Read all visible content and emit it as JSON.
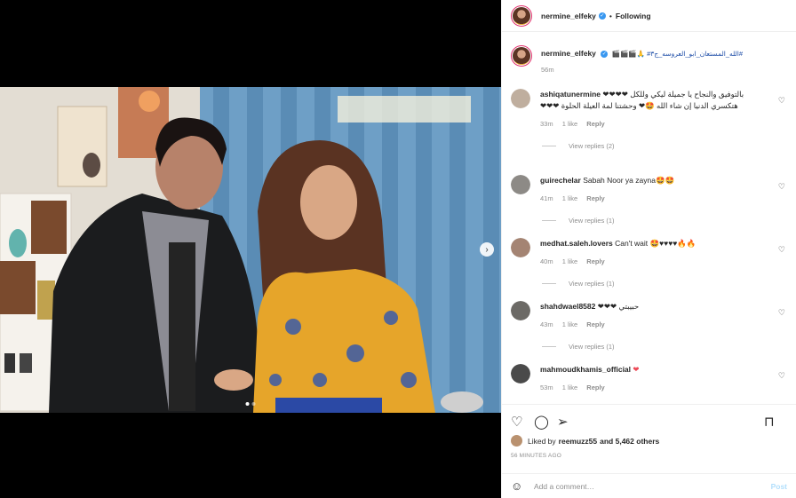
{
  "header": {
    "username": "nermine_elfeky",
    "separator": "•",
    "follow_label": "Following"
  },
  "caption": {
    "username": "nermine_elfeky",
    "text": "#الله_المستعان_ابو_العروسه_ج٣# 🙏🎬🎬🎬",
    "time": "56m"
  },
  "comments": [
    {
      "username": "ashiqatunermine",
      "text": "بالتوفيق والنجاح يا جميلة ليكي وللكل ❤❤❤❤ هتكسري الدنيا إن شاء الله 🤩❤ وحشتنا لمة العيلة الحلوة ❤❤❤",
      "time": "33m",
      "likes": "1 like",
      "reply": "Reply",
      "view_replies": "View replies (2)"
    },
    {
      "username": "guirechelar",
      "text": "Sabah Noor ya zayna🤩🤩",
      "time": "41m",
      "likes": "1 like",
      "reply": "Reply",
      "view_replies": "View replies (1)"
    },
    {
      "username": "medhat.saleh.lovers",
      "text": "Can't wait 🤩♥♥♥♥🔥🔥",
      "time": "40m",
      "likes": "1 like",
      "reply": "Reply",
      "view_replies": "View replies (1)"
    },
    {
      "username": "shahdwael8582",
      "text": "حبيبتي ❤❤❤",
      "time": "43m",
      "likes": "1 like",
      "reply": "Reply",
      "view_replies": "View replies (1)"
    },
    {
      "username": "mahmoudkhamis_official",
      "text": "❤",
      "time": "53m",
      "likes": "1 like",
      "reply": "Reply"
    }
  ],
  "likes_summary": {
    "prefix": "Liked by",
    "user": "reemuzz55",
    "suffix": "and 5,462 others"
  },
  "posted_ago": "56 MINUTES AGO",
  "add_comment": {
    "placeholder": "Add a comment…",
    "post_label": "Post"
  },
  "icons": {
    "heart": "heart-icon",
    "comment": "comment-icon",
    "share": "share-icon",
    "save": "bookmark-icon",
    "emoji": "emoji-icon",
    "next": "chevron-right-icon",
    "verified": "verified-badge-icon"
  },
  "colors": {
    "verified": "#3897f0",
    "heart_red": "#ed4956",
    "post_disabled": "#b2dffc",
    "muted": "#8e8e8e"
  }
}
